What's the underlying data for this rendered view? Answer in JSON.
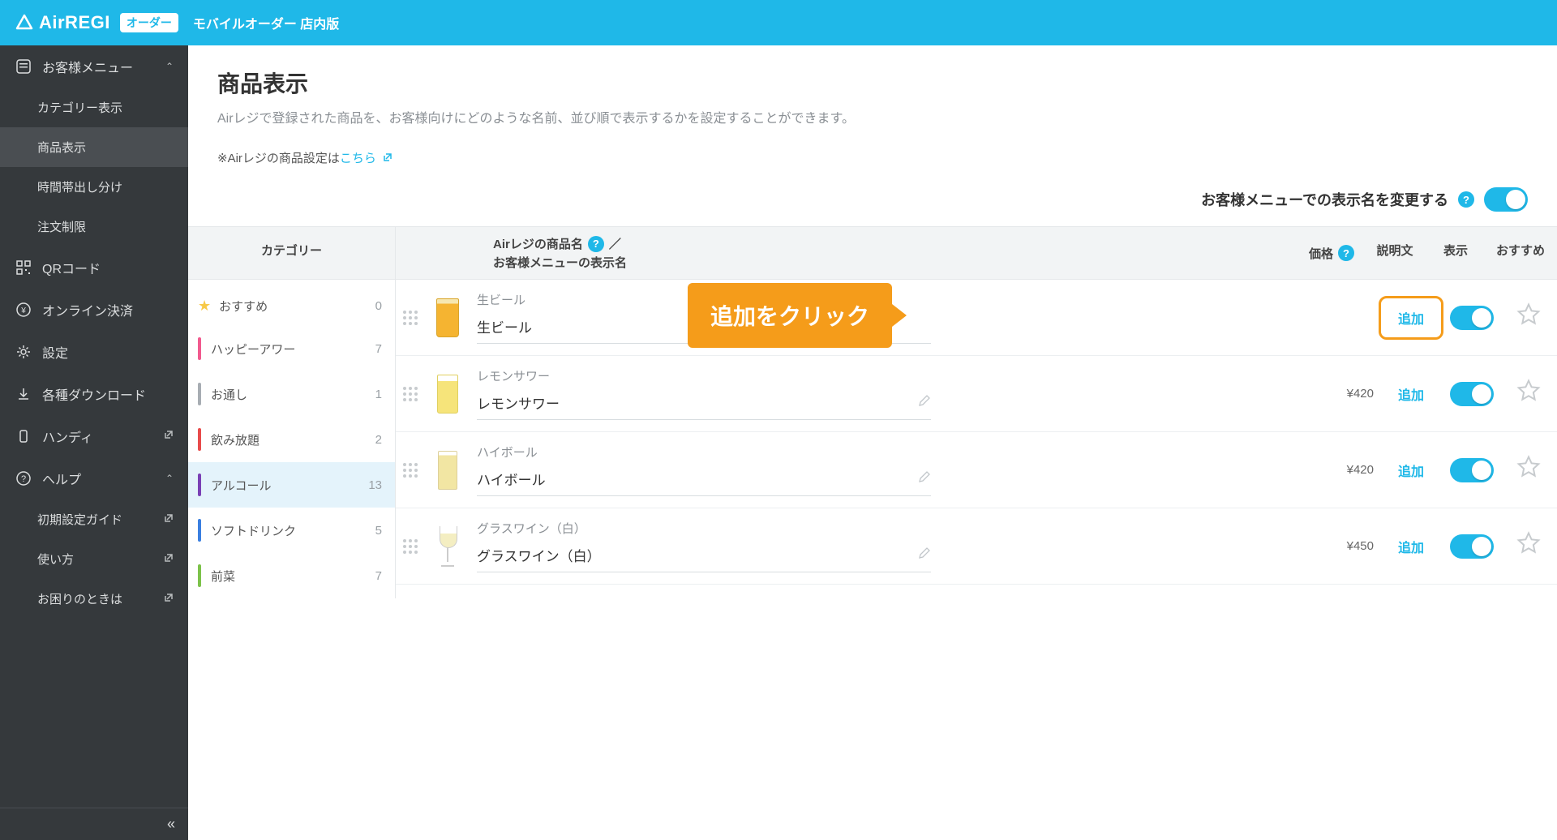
{
  "header": {
    "logo_text": "AirREGI",
    "logo_badge": "オーダー",
    "subtitle": "モバイルオーダー 店内版"
  },
  "sidebar": {
    "customer_menu": "お客様メニュー",
    "items": {
      "category_display": "カテゴリー表示",
      "product_display": "商品表示",
      "time_split": "時間帯出し分け",
      "order_limit": "注文制限"
    },
    "qr": "QRコード",
    "online_pay": "オンライン決済",
    "settings": "設定",
    "downloads": "各種ダウンロード",
    "handy": "ハンディ",
    "help": "ヘルプ",
    "help_items": {
      "guide": "初期設定ガイド",
      "howto": "使い方",
      "trouble": "お困りのときは"
    }
  },
  "page": {
    "title": "商品表示",
    "description": "Airレジで登録された商品を、お客様向けにどのような名前、並び順で表示するかを設定することができます。",
    "note_prefix": "※Airレジの商品設定は",
    "note_link": "こちら",
    "display_name_label": "お客様メニューでの表示名を変更する"
  },
  "columns": {
    "category": "カテゴリー",
    "name_line1": "Airレジの商品名",
    "name_sep": "／",
    "name_line2": "お客様メニューの表示名",
    "price": "価格",
    "desc": "説明文",
    "show": "表示",
    "recommend": "おすすめ"
  },
  "categories": [
    {
      "label": "おすすめ",
      "count": 0,
      "star": true
    },
    {
      "label": "ハッピーアワー",
      "count": 7,
      "color": "#f15a8e"
    },
    {
      "label": "お通し",
      "count": 1,
      "color": "#a7adb3"
    },
    {
      "label": "飲み放題",
      "count": 2,
      "color": "#e84b4b"
    },
    {
      "label": "アルコール",
      "count": 13,
      "color": "#7a3fb5",
      "selected": true
    },
    {
      "label": "ソフトドリンク",
      "count": 5,
      "color": "#3a7fe0"
    },
    {
      "label": "前菜",
      "count": 7,
      "color": "#7cc24a"
    }
  ],
  "products": [
    {
      "air_name": "生ビール",
      "disp_name": "生ビール",
      "price": "",
      "thumb": "beer",
      "highlight": true
    },
    {
      "air_name": "レモンサワー",
      "disp_name": "レモンサワー",
      "price": "¥420",
      "thumb": "lemon"
    },
    {
      "air_name": "ハイボール",
      "disp_name": "ハイボール",
      "price": "¥420",
      "thumb": "highball"
    },
    {
      "air_name": "グラスワイン（白）",
      "disp_name": "グラスワイン（白）",
      "price": "¥450",
      "thumb": "wine"
    }
  ],
  "labels": {
    "add": "追加",
    "callout": "追加をクリック"
  }
}
